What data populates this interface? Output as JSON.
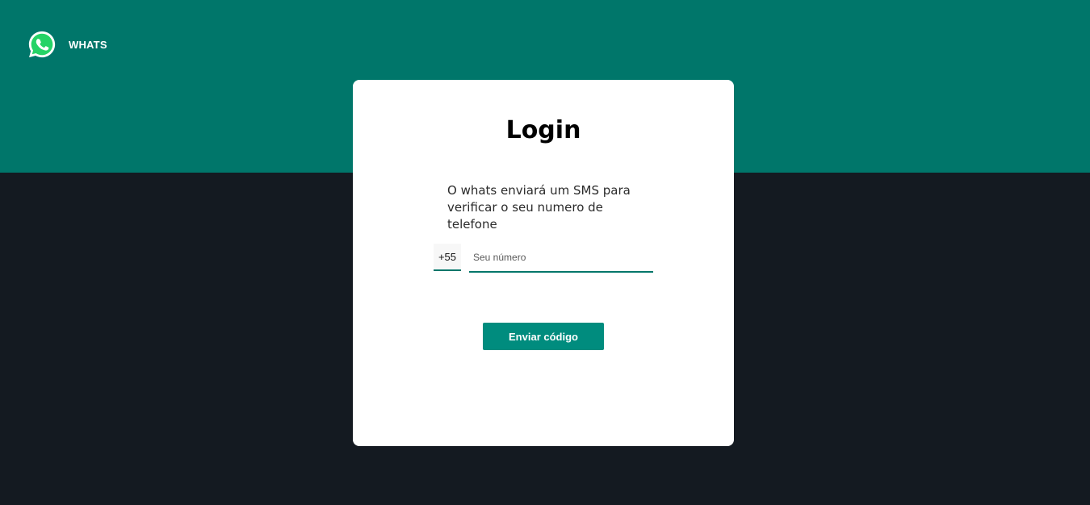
{
  "header": {
    "brand_name": "WHATS",
    "logo_icon": "whatsapp-logo-icon"
  },
  "login": {
    "title": "Login",
    "description": "O whats enviará um SMS para verificar o seu numero de telefone",
    "country_code": "+55",
    "phone_placeholder": "Seu número",
    "phone_value": "",
    "submit_label": "Enviar código"
  },
  "colors": {
    "header_band": "#00766a",
    "background": "#141a21",
    "card": "#ffffff",
    "button": "#008c7e",
    "logo_green": "#25d366"
  }
}
